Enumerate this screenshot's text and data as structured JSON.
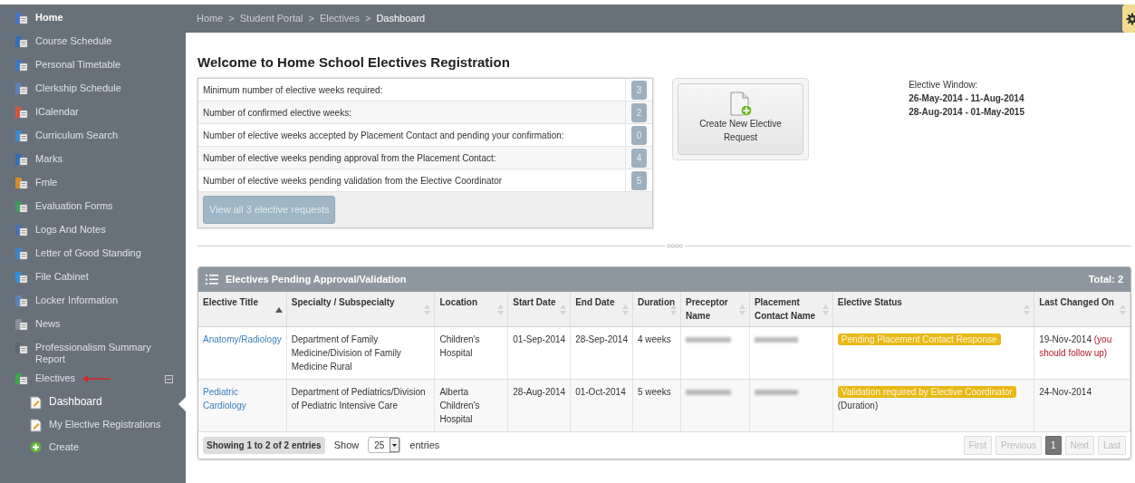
{
  "sidebar": {
    "items": [
      {
        "label": "Home",
        "selected": false,
        "bold": true
      },
      {
        "label": "Course Schedule",
        "selected": false
      },
      {
        "label": "Personal Timetable",
        "selected": false
      },
      {
        "label": "Clerkship Schedule",
        "selected": false
      },
      {
        "label": "ICalendar",
        "selected": false
      },
      {
        "label": "Curriculum Search",
        "selected": false
      },
      {
        "label": "Marks",
        "selected": false
      },
      {
        "label": "Fmle",
        "selected": false
      },
      {
        "label": "Evaluation Forms",
        "selected": false
      },
      {
        "label": "Logs And Notes",
        "selected": false
      },
      {
        "label": "Letter of Good Standing",
        "selected": false
      },
      {
        "label": "File Cabinet",
        "selected": false
      },
      {
        "label": "Locker Information",
        "selected": false
      },
      {
        "label": "News",
        "selected": false
      },
      {
        "label": "Professionalism Summary Report",
        "selected": false
      },
      {
        "label": "Electives",
        "selected": false,
        "expanded": true,
        "children": [
          {
            "label": "Dashboard",
            "selected": true,
            "kind": "page"
          },
          {
            "label": "My Elective Registrations",
            "selected": false,
            "kind": "page"
          },
          {
            "label": "Create",
            "selected": false,
            "kind": "add"
          }
        ]
      }
    ]
  },
  "breadcrumb": [
    {
      "label": "Home",
      "current": false
    },
    {
      "label": "Student Portal",
      "current": false
    },
    {
      "label": "Electives",
      "current": false
    },
    {
      "label": "Dashboard",
      "current": true
    }
  ],
  "breadcrumb_separator": ">",
  "title": "Welcome to Home School Electives Registration",
  "stats": [
    {
      "label": "Minimum number of elective weeks required:",
      "count": "3"
    },
    {
      "label": "Number of confirmed elective weeks:",
      "count": "2"
    },
    {
      "label": "Number of elective weeks accepted by Placement Contact and pending your confirmation:",
      "count": "0"
    },
    {
      "label": "Number of elective weeks pending approval from the Placement Contact:",
      "count": "4"
    },
    {
      "label": "Number of elective weeks pending validation from the Elective Coordinator",
      "count": "5"
    }
  ],
  "view_all_button": {
    "label": "View all 3 elective requests",
    "disabled": true
  },
  "create_button": {
    "label": "Create New Elective Request"
  },
  "elective_window": {
    "label": "Elective Window:",
    "ranges": [
      "26-May-2014 - 11-Aug-2014",
      "28-Aug-2014 - 01-May-2015"
    ]
  },
  "table": {
    "title": "Electives Pending Approval/Validation",
    "total": "Total: 2",
    "columns": [
      {
        "label": "Elective Title",
        "sorted_ascending": true
      },
      {
        "label": "Specialty / Subspecialty",
        "sorted_ascending": false
      },
      {
        "label": "Location",
        "sorted_ascending": false
      },
      {
        "label": "Start Date",
        "sorted_ascending": false
      },
      {
        "label": "End Date",
        "sorted_ascending": false
      },
      {
        "label": "Duration",
        "sorted_ascending": false
      },
      {
        "label": "Preceptor Name",
        "sorted_ascending": false
      },
      {
        "label": "Placement Contact Name",
        "sorted_ascending": false
      },
      {
        "label": "Elective Status",
        "sorted_ascending": false
      },
      {
        "label": "Last Changed On",
        "sorted_ascending": false
      }
    ],
    "rows": [
      {
        "title": "Anatomy/Radiology",
        "specialty": "Department of Family Medicine/Division of Family Medicine Rural",
        "location": "Children's Hospital",
        "start": "01-Sep-2014",
        "end": "28-Sep-2014",
        "duration": "4 weeks",
        "preceptor_redacted": true,
        "contact_redacted": true,
        "status": "Pending Placement Contact Response",
        "status_note": "",
        "last_changed": "19-Nov-2014",
        "warning": "(you should follow up)"
      },
      {
        "title": "Pediatric Cardiology",
        "specialty": "Department of Pediatrics/Division of Pediatric Intensive Care",
        "location": "Alberta Children's Hospital",
        "start": "28-Aug-2014",
        "end": "01-Oct-2014",
        "duration": "5 weeks",
        "preceptor_redacted": true,
        "contact_redacted": true,
        "status": "Validation required by Elective Coordinator",
        "status_note": "(Duration)",
        "last_changed": "24-Nov-2014",
        "warning": ""
      }
    ],
    "info": "Showing 1 to 2 of 2 entries",
    "length_label_before": "Show",
    "length_value": "25",
    "length_label_after": "entries",
    "pagination": [
      {
        "label": "First",
        "selected": false,
        "disabled": true
      },
      {
        "label": "Previous",
        "selected": false,
        "disabled": true
      },
      {
        "label": "1",
        "selected": true,
        "disabled": false
      },
      {
        "label": "Next",
        "selected": false,
        "disabled": true
      },
      {
        "label": "Last",
        "selected": false,
        "disabled": true
      }
    ]
  }
}
